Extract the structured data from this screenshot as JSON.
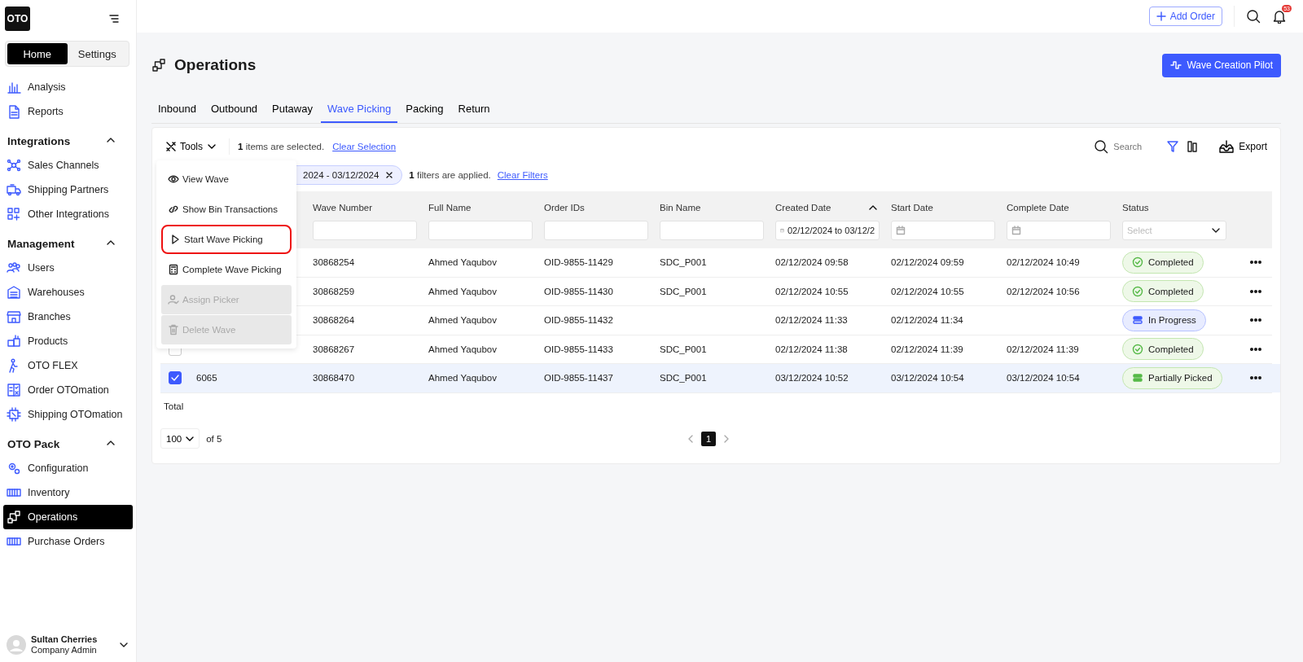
{
  "sidebar": {
    "logo": "OTO",
    "mode_tabs": [
      {
        "label": "Home",
        "selected": true
      },
      {
        "label": "Settings",
        "selected": false
      }
    ],
    "top_items": [
      {
        "label": "Analysis",
        "selected": false
      },
      {
        "label": "Reports",
        "selected": false
      }
    ],
    "sections": [
      {
        "title": "Integrations",
        "expanded": true,
        "items": [
          {
            "label": "Sales Channels",
            "selected": false
          },
          {
            "label": "Shipping Partners",
            "selected": false
          },
          {
            "label": "Other Integrations",
            "selected": false
          }
        ]
      },
      {
        "title": "Management",
        "expanded": true,
        "items": [
          {
            "label": "Users",
            "selected": false
          },
          {
            "label": "Warehouses",
            "selected": false
          },
          {
            "label": "Branches",
            "selected": false
          },
          {
            "label": "Products",
            "selected": false
          },
          {
            "label": "OTO FLEX",
            "selected": false
          },
          {
            "label": "Order OTOmation",
            "selected": false
          },
          {
            "label": "Shipping OTOmation",
            "selected": false
          }
        ]
      },
      {
        "title": "OTO Pack",
        "expanded": true,
        "items": [
          {
            "label": "Configuration",
            "selected": false
          },
          {
            "label": "Inventory",
            "selected": false
          },
          {
            "label": "Operations",
            "selected": true
          },
          {
            "label": "Purchase Orders",
            "selected": false
          }
        ]
      }
    ],
    "user": {
      "name": "Sultan Cherries",
      "role": "Company Admin"
    }
  },
  "topbar": {
    "add_button": "Add Order",
    "notification_count": "53"
  },
  "page": {
    "title": "Operations",
    "pilot_button": "Wave Creation Pilot"
  },
  "tabs": [
    {
      "label": "Inbound",
      "selected": false
    },
    {
      "label": "Outbound",
      "selected": false
    },
    {
      "label": "Putaway",
      "selected": false
    },
    {
      "label": "Wave Picking",
      "selected": true
    },
    {
      "label": "Packing",
      "selected": false
    },
    {
      "label": "Return",
      "selected": false
    }
  ],
  "toolbar": {
    "tools": "Tools",
    "selection_count": "1",
    "selection_text": "items are selected.",
    "clear_selection": "Clear Selection",
    "search_placeholder": "Search",
    "export": "Export"
  },
  "filters": {
    "chip": "2024 - 03/12/2024",
    "count": "1",
    "text": "filters are applied.",
    "clear": "Clear Filters"
  },
  "tools_menu": [
    {
      "label": "View Wave",
      "disabled": false,
      "highlighted": false
    },
    {
      "label": "Show Bin Transactions",
      "disabled": false,
      "highlighted": false
    },
    {
      "label": "Start Wave Picking",
      "disabled": false,
      "highlighted": true
    },
    {
      "label": "Complete Wave Picking",
      "disabled": false,
      "highlighted": false
    },
    {
      "label": "Assign Picker",
      "disabled": true,
      "highlighted": false
    },
    {
      "label": "Delete Wave",
      "disabled": true,
      "highlighted": false
    }
  ],
  "table": {
    "columns": [
      {
        "label": "Wave Number",
        "kind": "text"
      },
      {
        "label": "Full Name",
        "kind": "text"
      },
      {
        "label": "Order IDs",
        "kind": "text"
      },
      {
        "label": "Bin Name",
        "kind": "text"
      },
      {
        "label": "Created Date",
        "kind": "date",
        "value": "02/12/2024 to 03/12/2",
        "sorted": true
      },
      {
        "label": "Start Date",
        "kind": "date"
      },
      {
        "label": "Complete Date",
        "kind": "date"
      },
      {
        "label": "Status",
        "kind": "select",
        "placeholder": "Select"
      }
    ],
    "rows": [
      {
        "selected": false,
        "cells": [
          "30868254",
          "Ahmed Yaqubov",
          "OID-9855-11429",
          "SDC_P001",
          "02/12/2024 09:58",
          "02/12/2024 09:59",
          "02/12/2024 10:49"
        ],
        "status": {
          "kind": "completed",
          "label": "Completed"
        }
      },
      {
        "selected": false,
        "cells": [
          "30868259",
          "Ahmed Yaqubov",
          "OID-9855-11430",
          "SDC_P001",
          "02/12/2024 10:55",
          "02/12/2024 10:55",
          "02/12/2024 10:56"
        ],
        "status": {
          "kind": "completed",
          "label": "Completed"
        }
      },
      {
        "selected": false,
        "cells": [
          "30868264",
          "Ahmed Yaqubov",
          "OID-9855-11432",
          "",
          "02/12/2024 11:33",
          "02/12/2024 11:34",
          ""
        ],
        "status": {
          "kind": "in_progress",
          "label": "In Progress"
        }
      },
      {
        "selected": false,
        "cells": [
          "30868267",
          "Ahmed Yaqubov",
          "OID-9855-11433",
          "SDC_P001",
          "02/12/2024 11:38",
          "02/12/2024 11:39",
          "02/12/2024 11:39"
        ],
        "status": {
          "kind": "completed",
          "label": "Completed"
        }
      },
      {
        "selected": true,
        "id": "6065",
        "cells": [
          "30868470",
          "Ahmed Yaqubov",
          "OID-9855-11437",
          "SDC_P001",
          "03/12/2024 10:52",
          "03/12/2024 10:54",
          "03/12/2024 10:54"
        ],
        "status": {
          "kind": "partially_picked",
          "label": "Partially Picked"
        }
      }
    ],
    "total_label": "Total"
  },
  "pagination": {
    "page_size": "100",
    "of_text": "of 5",
    "pages": [
      {
        "label": "1",
        "selected": true
      }
    ]
  }
}
